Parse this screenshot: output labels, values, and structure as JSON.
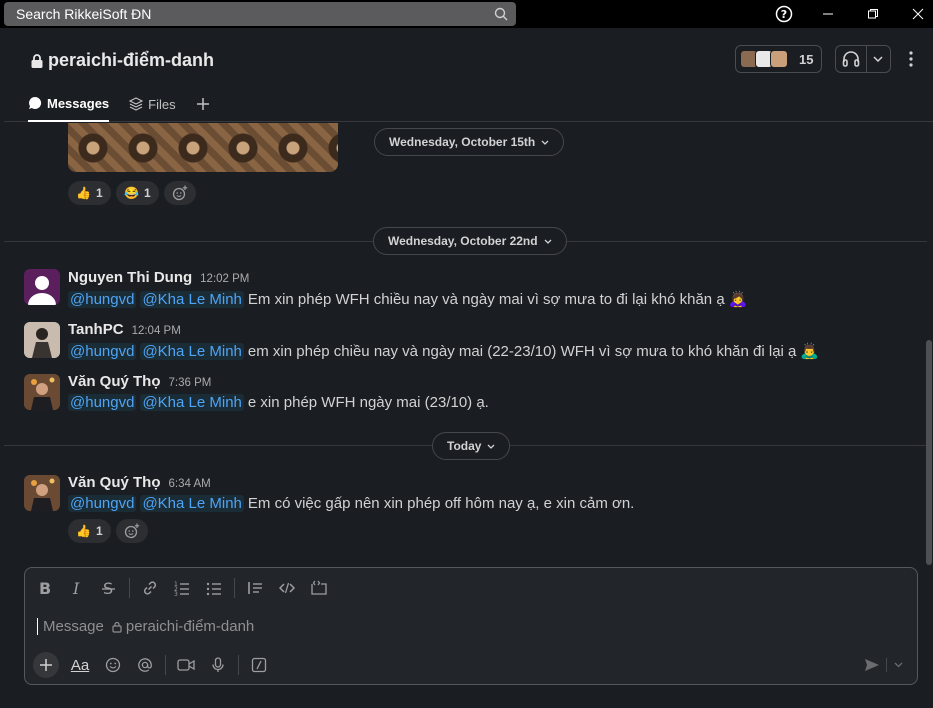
{
  "titlebar": {
    "search_placeholder": "Search RikkeiSoft ĐN",
    "icons": [
      "search-icon",
      "help-icon",
      "minimize-icon",
      "restore-icon",
      "close-icon"
    ]
  },
  "channel": {
    "name": "peraichi-điểm-danh",
    "member_count": "15",
    "tabs": [
      {
        "label": "Messages",
        "icon": "message-icon",
        "active": true
      },
      {
        "label": "Files",
        "icon": "layers-icon",
        "active": false
      }
    ]
  },
  "dividers": [
    {
      "label": "Wednesday, October 15th"
    },
    {
      "label": "Wednesday, October 22nd"
    },
    {
      "label": "Today"
    }
  ],
  "top_reactions": [
    {
      "emoji": "👍",
      "count": "1"
    },
    {
      "emoji": "😂",
      "count": "1"
    }
  ],
  "messages": [
    {
      "name": "Nguyen Thi Dung",
      "time": "12:02 PM",
      "mentions": [
        "@hungvd",
        "@Kha Le Minh"
      ],
      "text": "Em xin phép WFH chiều nay và ngày mai vì sợ mưa to đi lại khó khăn ạ",
      "emoji": "🙇‍♀️"
    },
    {
      "name": "TanhPC",
      "time": "12:04 PM",
      "mentions": [
        "@hungvd",
        "@Kha Le Minh"
      ],
      "text": "em xin phép chiều nay và ngày mai (22-23/10) WFH vì sợ mưa to khó khăn đi lại ạ",
      "emoji": "🙇‍♂️"
    },
    {
      "name": "Văn Quý Thọ",
      "time": "7:36 PM",
      "mentions": [
        "@hungvd",
        "@Kha Le Minh"
      ],
      "text": "e xin phép WFH ngày mai (23/10) ạ."
    },
    {
      "name": "Văn Quý Thọ",
      "time": "6:34 AM",
      "mentions": [
        "@hungvd",
        "@Kha Le Minh"
      ],
      "text": "Em có việc gấp nên xin phép off hôm nay ạ, e xin cảm ơn.",
      "reactions": [
        {
          "emoji": "👍",
          "count": "1"
        }
      ]
    }
  ],
  "composer": {
    "placeholder": "Message",
    "channel": "peraichi-điểm-danh",
    "aa_label": "Aa"
  },
  "colors": {
    "background": "#1a1d21",
    "mention": "#4fa4f5",
    "titlebar": "#000000"
  }
}
